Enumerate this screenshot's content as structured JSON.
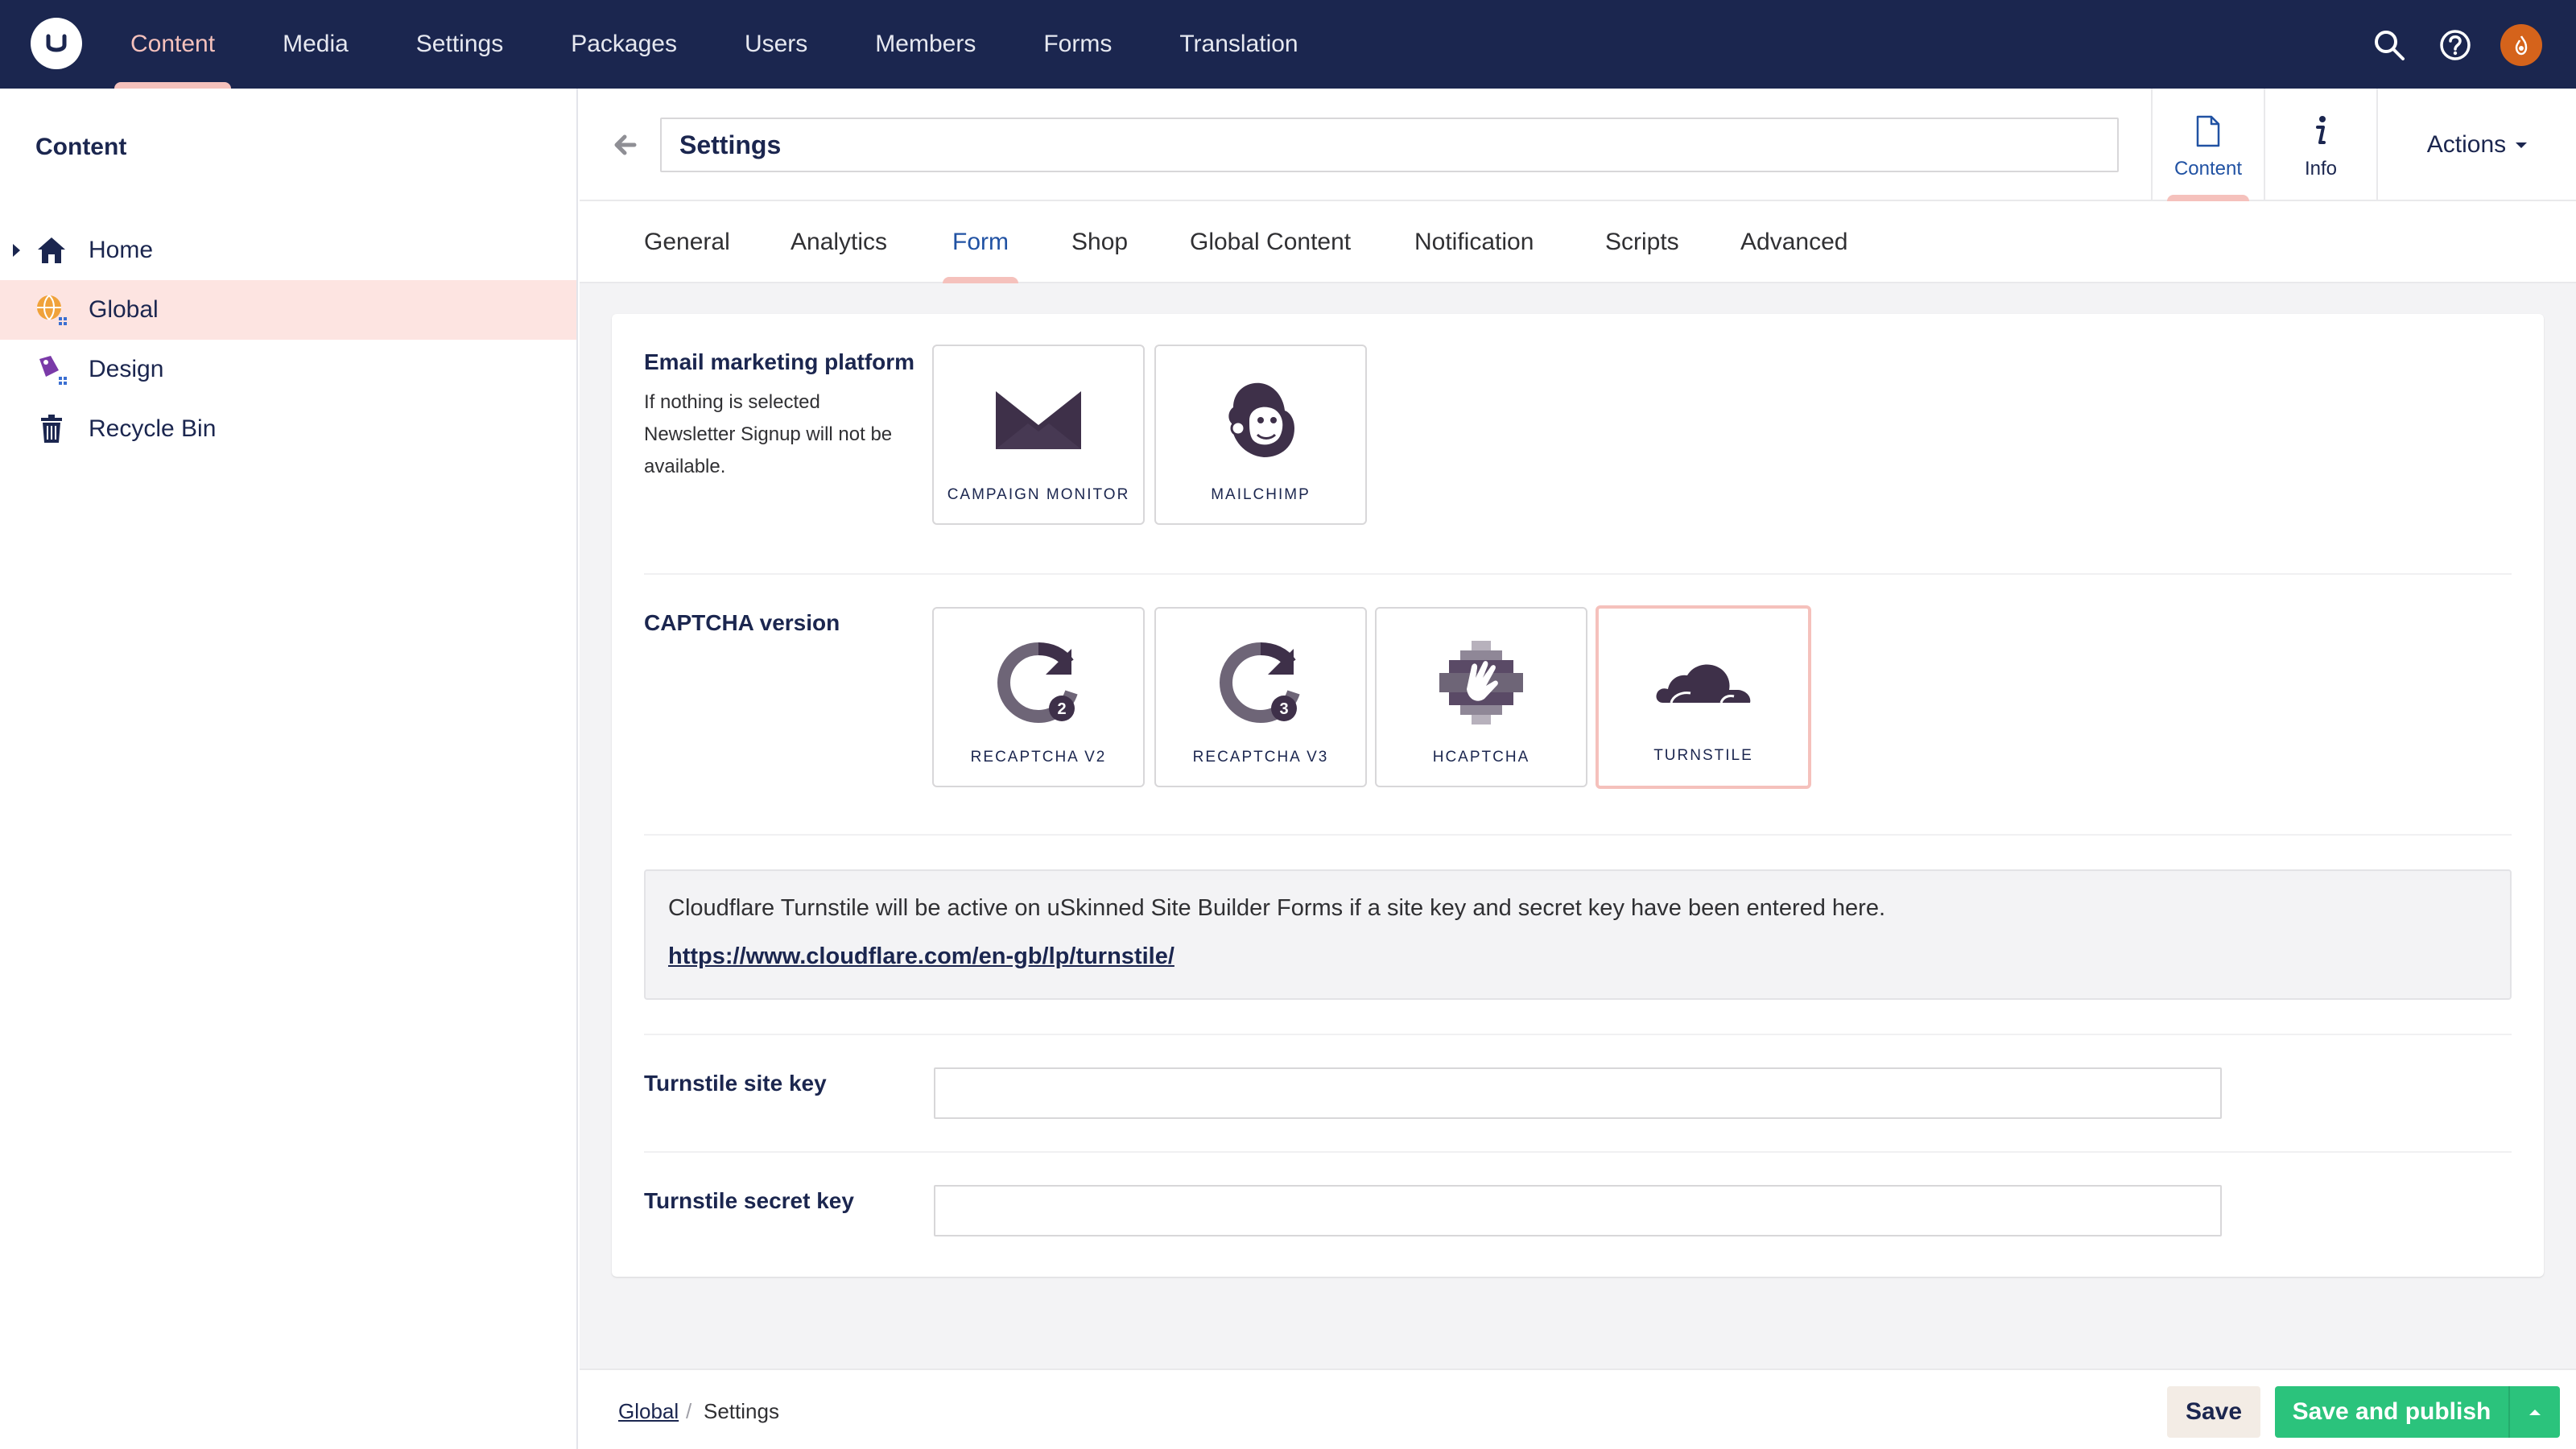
{
  "header": {
    "nav": [
      "Content",
      "Media",
      "Settings",
      "Packages",
      "Users",
      "Members",
      "Forms",
      "Translation"
    ],
    "active_nav": "Content",
    "icons": [
      "search-icon",
      "help-icon",
      "user-avatar"
    ]
  },
  "sidebar": {
    "title": "Content",
    "items": [
      {
        "label": "Home",
        "icon": "home-icon"
      },
      {
        "label": "Global",
        "icon": "globe-icon"
      },
      {
        "label": "Design",
        "icon": "palette-icon"
      },
      {
        "label": "Recycle Bin",
        "icon": "trash-icon"
      }
    ],
    "selected": "Global"
  },
  "editor": {
    "node_name": "Settings",
    "apps": [
      {
        "label": "Content",
        "icon": "document-icon"
      },
      {
        "label": "Info",
        "icon": "info-icon"
      }
    ],
    "actions_label": "Actions"
  },
  "tabs": [
    "General",
    "Analytics",
    "Form",
    "Shop",
    "Global Content",
    "Notification",
    "Scripts",
    "Advanced"
  ],
  "active_tab": "Form",
  "form": {
    "email_platform": {
      "label": "Email marketing platform",
      "description": "If nothing is selected Newsletter Signup will not be available.",
      "options": [
        "CAMPAIGN MONITOR",
        "MAILCHIMP"
      ]
    },
    "captcha": {
      "label": "CAPTCHA version",
      "options": [
        "RECAPTCHA V2",
        "RECAPTCHA V3",
        "HCAPTCHA",
        "TURNSTILE"
      ],
      "selected": "TURNSTILE"
    },
    "info": {
      "text": "Cloudflare Turnstile will be active on uSkinned Site Builder Forms if a site key and secret key have been entered here.",
      "link": "https://www.cloudflare.com/en-gb/lp/turnstile/"
    },
    "site_key": {
      "label": "Turnstile site key",
      "value": ""
    },
    "secret_key": {
      "label": "Turnstile secret key",
      "value": ""
    }
  },
  "footer": {
    "breadcrumb": [
      "Global",
      "Settings"
    ],
    "separator": "/",
    "save_label": "Save",
    "publish_label": "Save and publish"
  },
  "colors": {
    "header_bg": "#1b264f",
    "accent_pink": "#f5c1bc",
    "publish_green": "#2bc37c",
    "selected_row": "#fde4e1"
  }
}
